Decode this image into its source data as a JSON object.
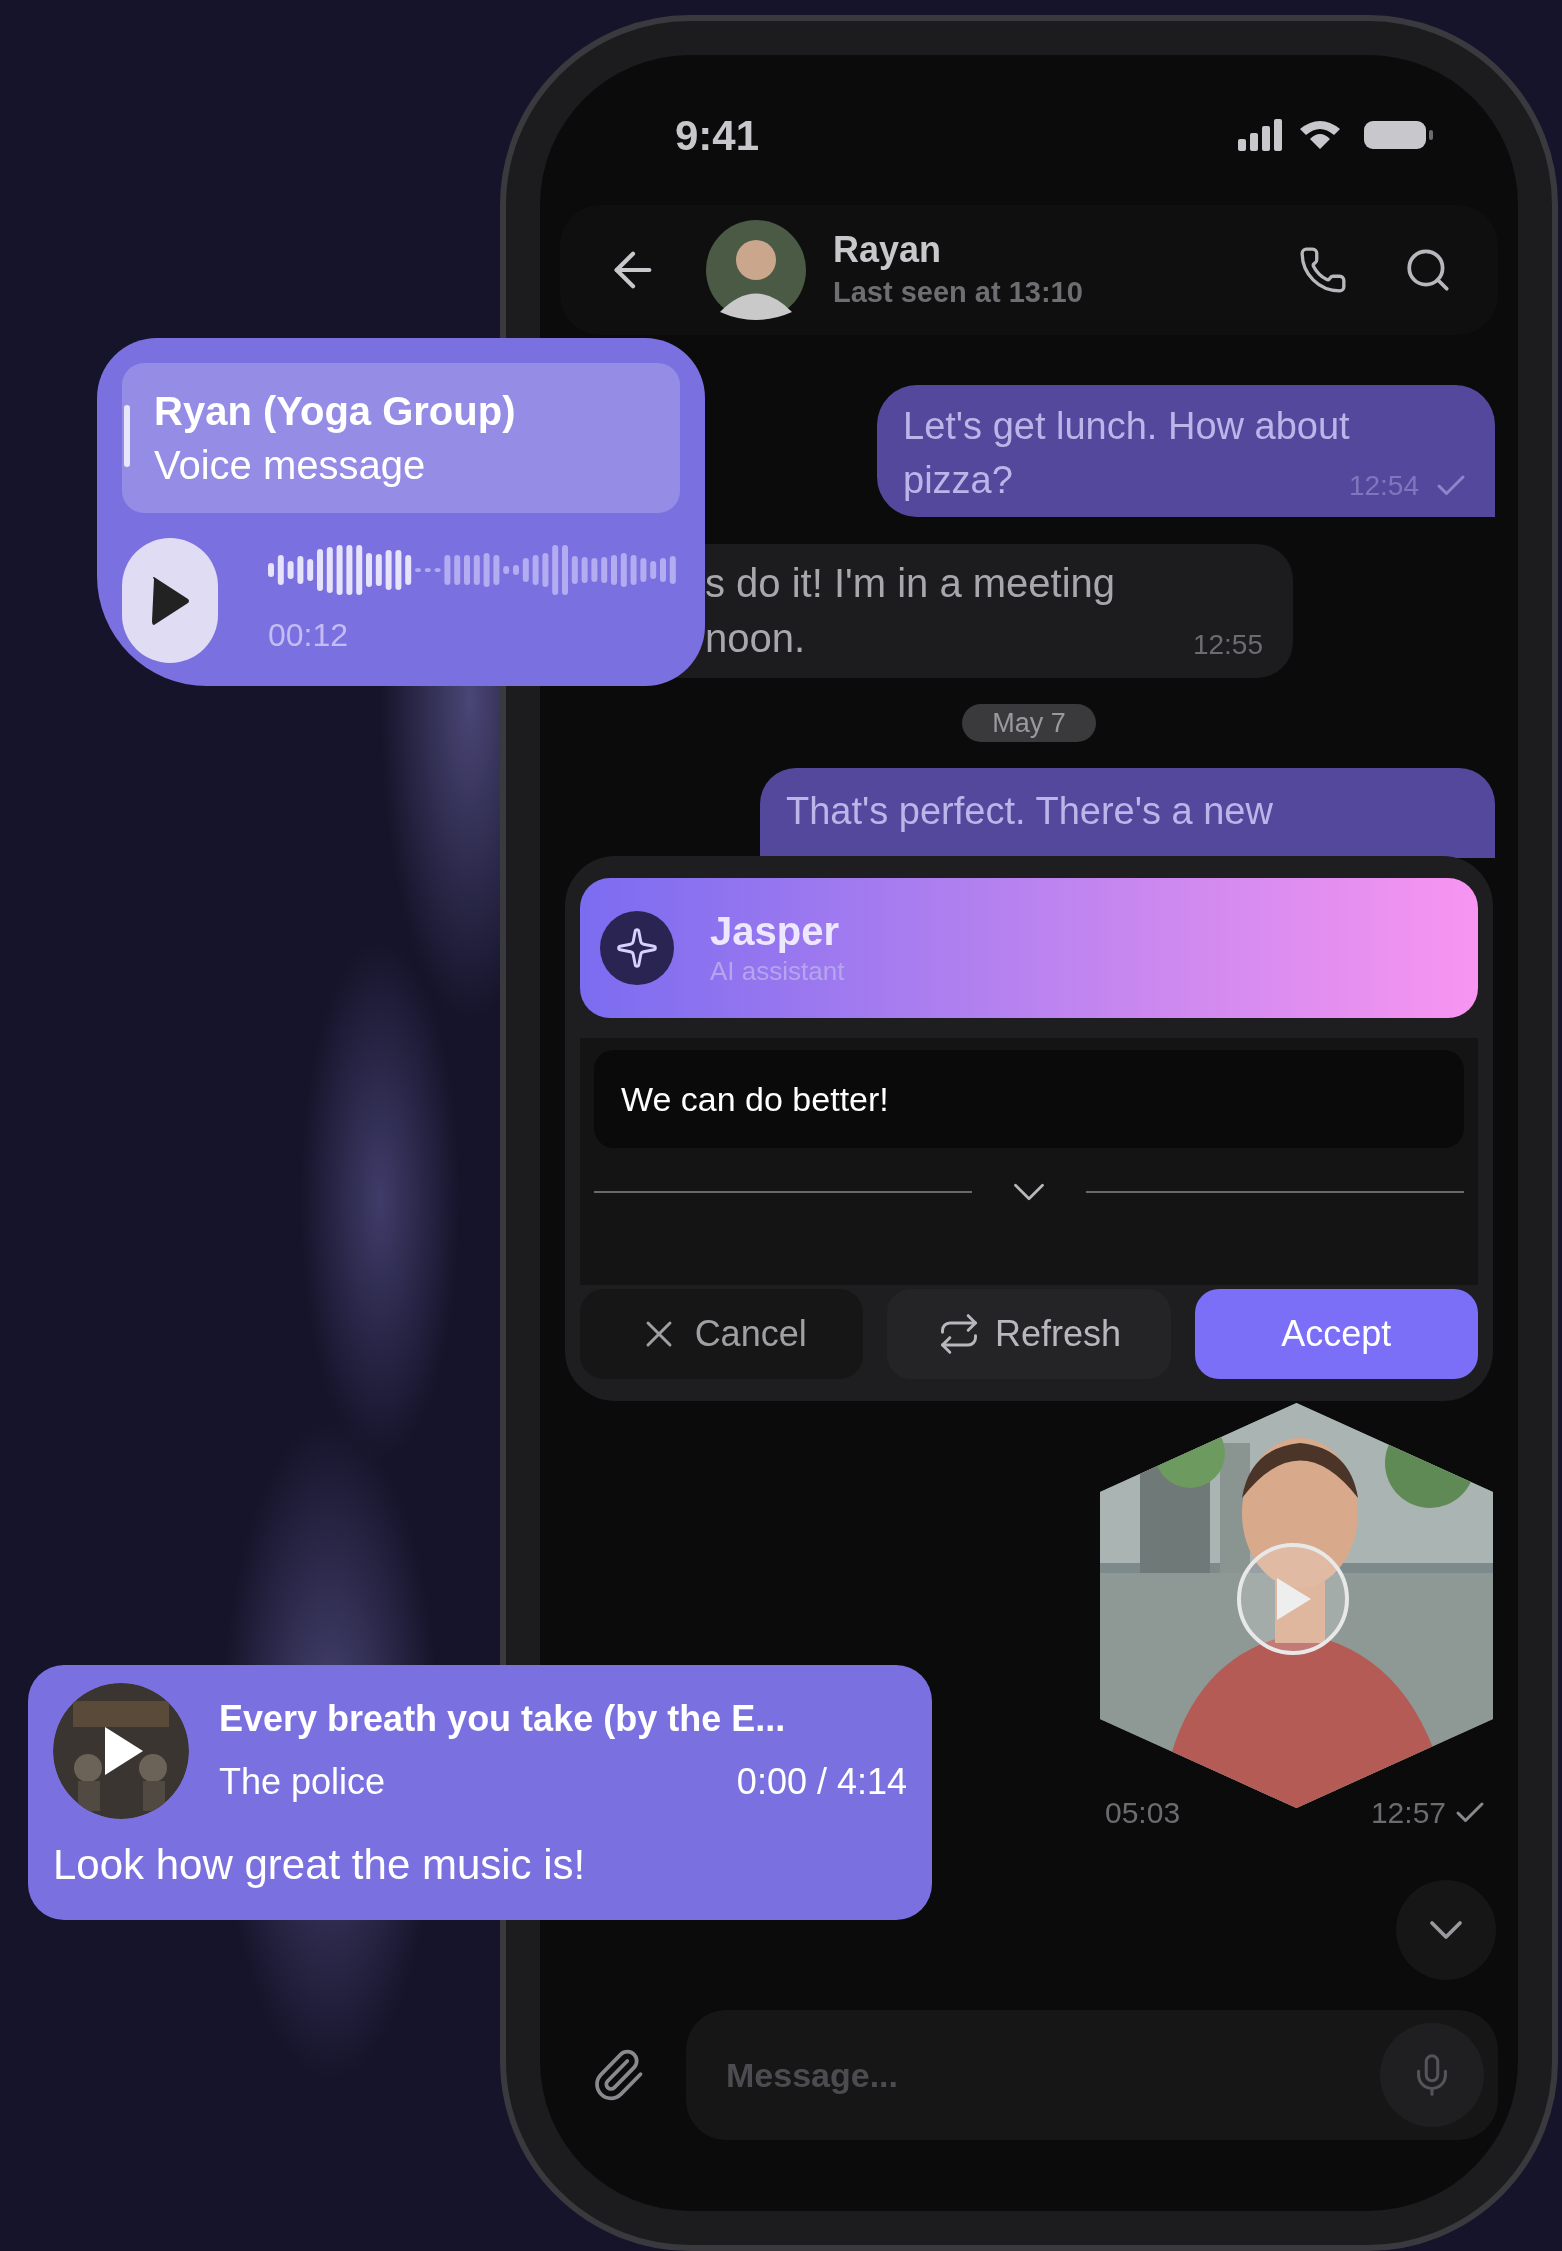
{
  "status_bar": {
    "time": "9:41"
  },
  "chat_header": {
    "name": "Rayan",
    "status": "Last seen at 13:10"
  },
  "messages": [
    {
      "kind": "outgoing",
      "lines": [
        "Let's get lunch. How about",
        "pizza?"
      ],
      "time": "12:54",
      "read": true
    },
    {
      "kind": "incoming",
      "lines": [
        "s do it! I'm in a meeting",
        "noon."
      ],
      "time": "12:55"
    },
    {
      "kind": "date",
      "label": "May 7"
    },
    {
      "kind": "outgoing",
      "lines": [
        "That's perfect. There's a new"
      ]
    }
  ],
  "ai_panel": {
    "name": "Jasper",
    "role": "AI assistant",
    "suggestion": "We can do better!",
    "buttons": [
      {
        "kind": "cancel",
        "label": "Cancel"
      },
      {
        "kind": "refresh",
        "label": "Refresh"
      },
      {
        "kind": "accept",
        "label": "Accept"
      }
    ]
  },
  "video_message": {
    "duration": "05:03",
    "time": "12:57",
    "read": true
  },
  "composer": {
    "placeholder": "Message..."
  },
  "voice_card": {
    "sender": "Ryan (Yoga Group)",
    "label": "Voice message",
    "duration": "00:12"
  },
  "music_card": {
    "title": "Every breath you take (by the E...",
    "artist": "The police",
    "position": "0:00 / 4:14",
    "caption": "Look how great the music is!"
  }
}
